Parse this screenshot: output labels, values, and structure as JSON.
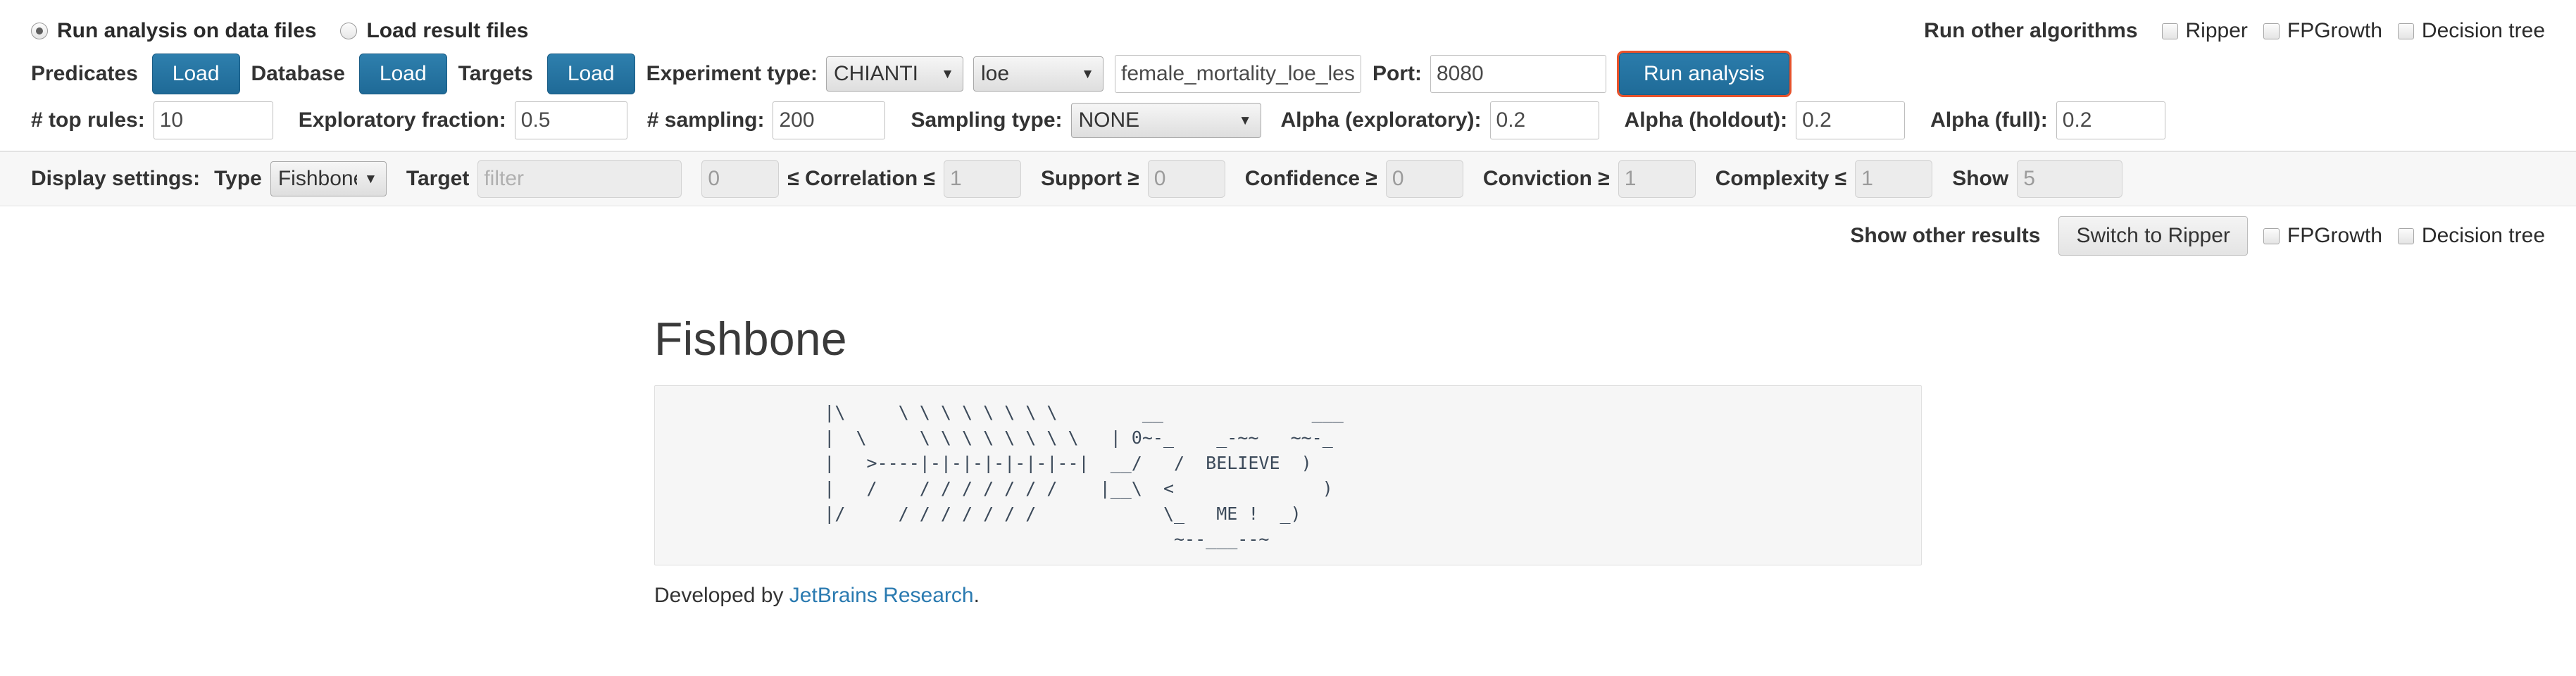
{
  "mode": {
    "run_label": "Run analysis on data files",
    "load_label": "Load result files"
  },
  "run_other": {
    "title": "Run other algorithms",
    "options": [
      {
        "label": "Ripper",
        "checked": false
      },
      {
        "label": "FPGrowth",
        "checked": false
      },
      {
        "label": "Decision tree",
        "checked": false
      }
    ]
  },
  "sources": {
    "predicates_label": "Predicates",
    "predicates_button": "Load",
    "database_label": "Database",
    "database_button": "Load",
    "targets_label": "Targets",
    "targets_button": "Load"
  },
  "experiment": {
    "label": "Experiment type:",
    "type_value": "CHIANTI",
    "subtype_value": "loe",
    "dataset_value": "female_mortality_loe_less_s",
    "port_label": "Port:",
    "port_value": "8080",
    "run_button": "Run analysis"
  },
  "params": {
    "top_rules_label": "# top rules:",
    "top_rules_value": "10",
    "exploratory_fraction_label": "Exploratory fraction:",
    "exploratory_fraction_value": "0.5",
    "sampling_label": "# sampling:",
    "sampling_value": "200",
    "sampling_type_label": "Sampling type:",
    "sampling_type_value": "NONE",
    "alpha_exploratory_label": "Alpha (exploratory):",
    "alpha_exploratory_value": "0.2",
    "alpha_holdout_label": "Alpha (holdout):",
    "alpha_holdout_value": "0.2",
    "alpha_full_label": "Alpha (full):",
    "alpha_full_value": "0.2"
  },
  "display": {
    "title": "Display settings:",
    "type_label": "Type",
    "type_value": "Fishbone",
    "target_label": "Target",
    "target_placeholder": "filter",
    "target_value": "",
    "correlation_min": "0",
    "correlation_label": "≤ Correlation ≤",
    "correlation_max": "1",
    "support_label": "Support ≥",
    "support_value": "0",
    "confidence_label": "Confidence ≥",
    "confidence_value": "0",
    "conviction_label": "Conviction ≥",
    "conviction_value": "1",
    "complexity_label": "Complexity ≤",
    "complexity_value": "1",
    "show_label": "Show",
    "show_value": "5"
  },
  "other_results": {
    "title": "Show other results",
    "switch_button": "Switch to Ripper",
    "options": [
      {
        "label": "FPGrowth",
        "checked": false
      },
      {
        "label": "Decision tree",
        "checked": false
      }
    ]
  },
  "main": {
    "title": "Fishbone",
    "ascii_art": "      |\\     \\ \\ \\ \\ \\ \\ \\ \\        __              ___\n      |  \\     \\ \\ \\ \\ \\ \\ \\ \\   | 0~-_    _-~~   ~~-_\n      |   >----|-|-|-|-|-|-|--|  __/   /  BELIEVE  )\n      |   /    / / / / / / /    |__\\  <              )\n      |/     / / / / / / /            \\_   ME !  _)\n                                       ~--___--~"
  },
  "footer": {
    "prefix": "Developed by ",
    "link": "JetBrains Research",
    "suffix": "."
  },
  "colors": {
    "accent_blue": "#2a7ab0",
    "button_blue": "#1f6a97",
    "focus_orange": "#e8522b",
    "ascii_text": "#3c4a5a"
  }
}
